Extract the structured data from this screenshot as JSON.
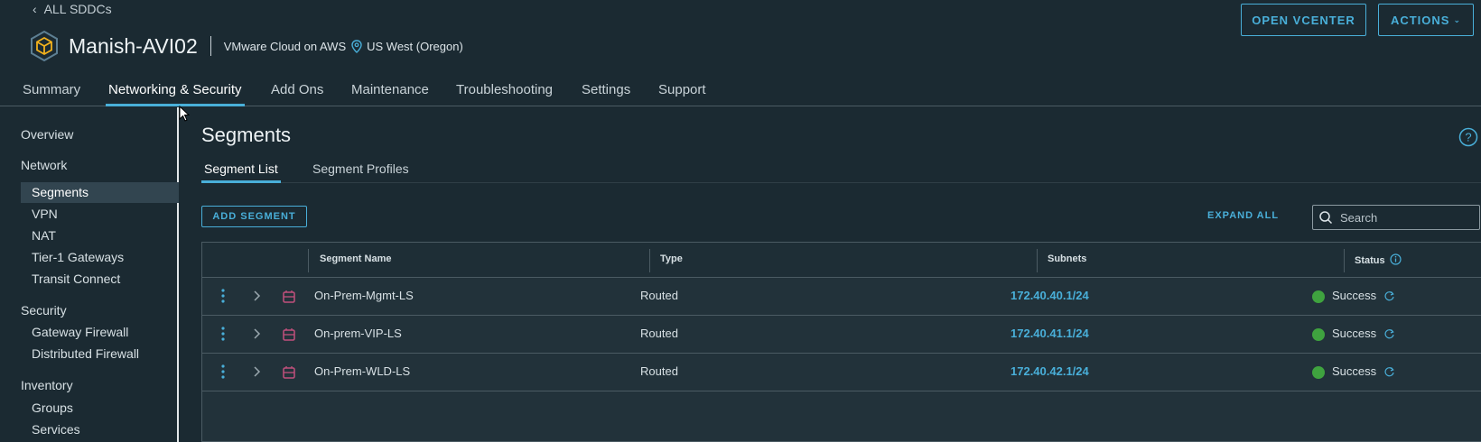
{
  "header": {
    "back_link": "ALL SDDCs",
    "sddc_name": "Manish-AVI02",
    "cloud": "VMware Cloud on AWS",
    "region": "US West (Oregon)",
    "open_vcenter": "OPEN VCENTER",
    "actions": "ACTIONS"
  },
  "main_tabs": [
    {
      "label": "Summary"
    },
    {
      "label": "Networking & Security",
      "active": true
    },
    {
      "label": "Add Ons"
    },
    {
      "label": "Maintenance"
    },
    {
      "label": "Troubleshooting"
    },
    {
      "label": "Settings"
    },
    {
      "label": "Support"
    }
  ],
  "sidebar": {
    "overview": "Overview",
    "network": {
      "heading": "Network",
      "items": [
        "Segments",
        "VPN",
        "NAT",
        "Tier-1 Gateways",
        "Transit Connect"
      ]
    },
    "security": {
      "heading": "Security",
      "items": [
        "Gateway Firewall",
        "Distributed Firewall"
      ]
    },
    "inventory": {
      "heading": "Inventory",
      "items": [
        "Groups",
        "Services"
      ]
    },
    "active_item": "Segments"
  },
  "content": {
    "title": "Segments",
    "sub_tabs": [
      {
        "label": "Segment List",
        "active": true
      },
      {
        "label": "Segment Profiles"
      }
    ],
    "add_segment": "ADD SEGMENT",
    "expand_all": "EXPAND ALL",
    "search_placeholder": "Search"
  },
  "table": {
    "columns": [
      "Segment Name",
      "Type",
      "Subnets",
      "Status"
    ],
    "rows": [
      {
        "name": "On-Prem-Mgmt-LS",
        "type": "Routed",
        "subnet": "172.40.40.1/24",
        "status": "Success"
      },
      {
        "name": "On-prem-VIP-LS",
        "type": "Routed",
        "subnet": "172.40.41.1/24",
        "status": "Success"
      },
      {
        "name": "On-Prem-WLD-LS",
        "type": "Routed",
        "subnet": "172.40.42.1/24",
        "status": "Success"
      }
    ]
  },
  "colors": {
    "accent": "#49afd9",
    "background": "#1b2a32",
    "success": "#3fa33f",
    "segment_icon": "#c2507d"
  }
}
